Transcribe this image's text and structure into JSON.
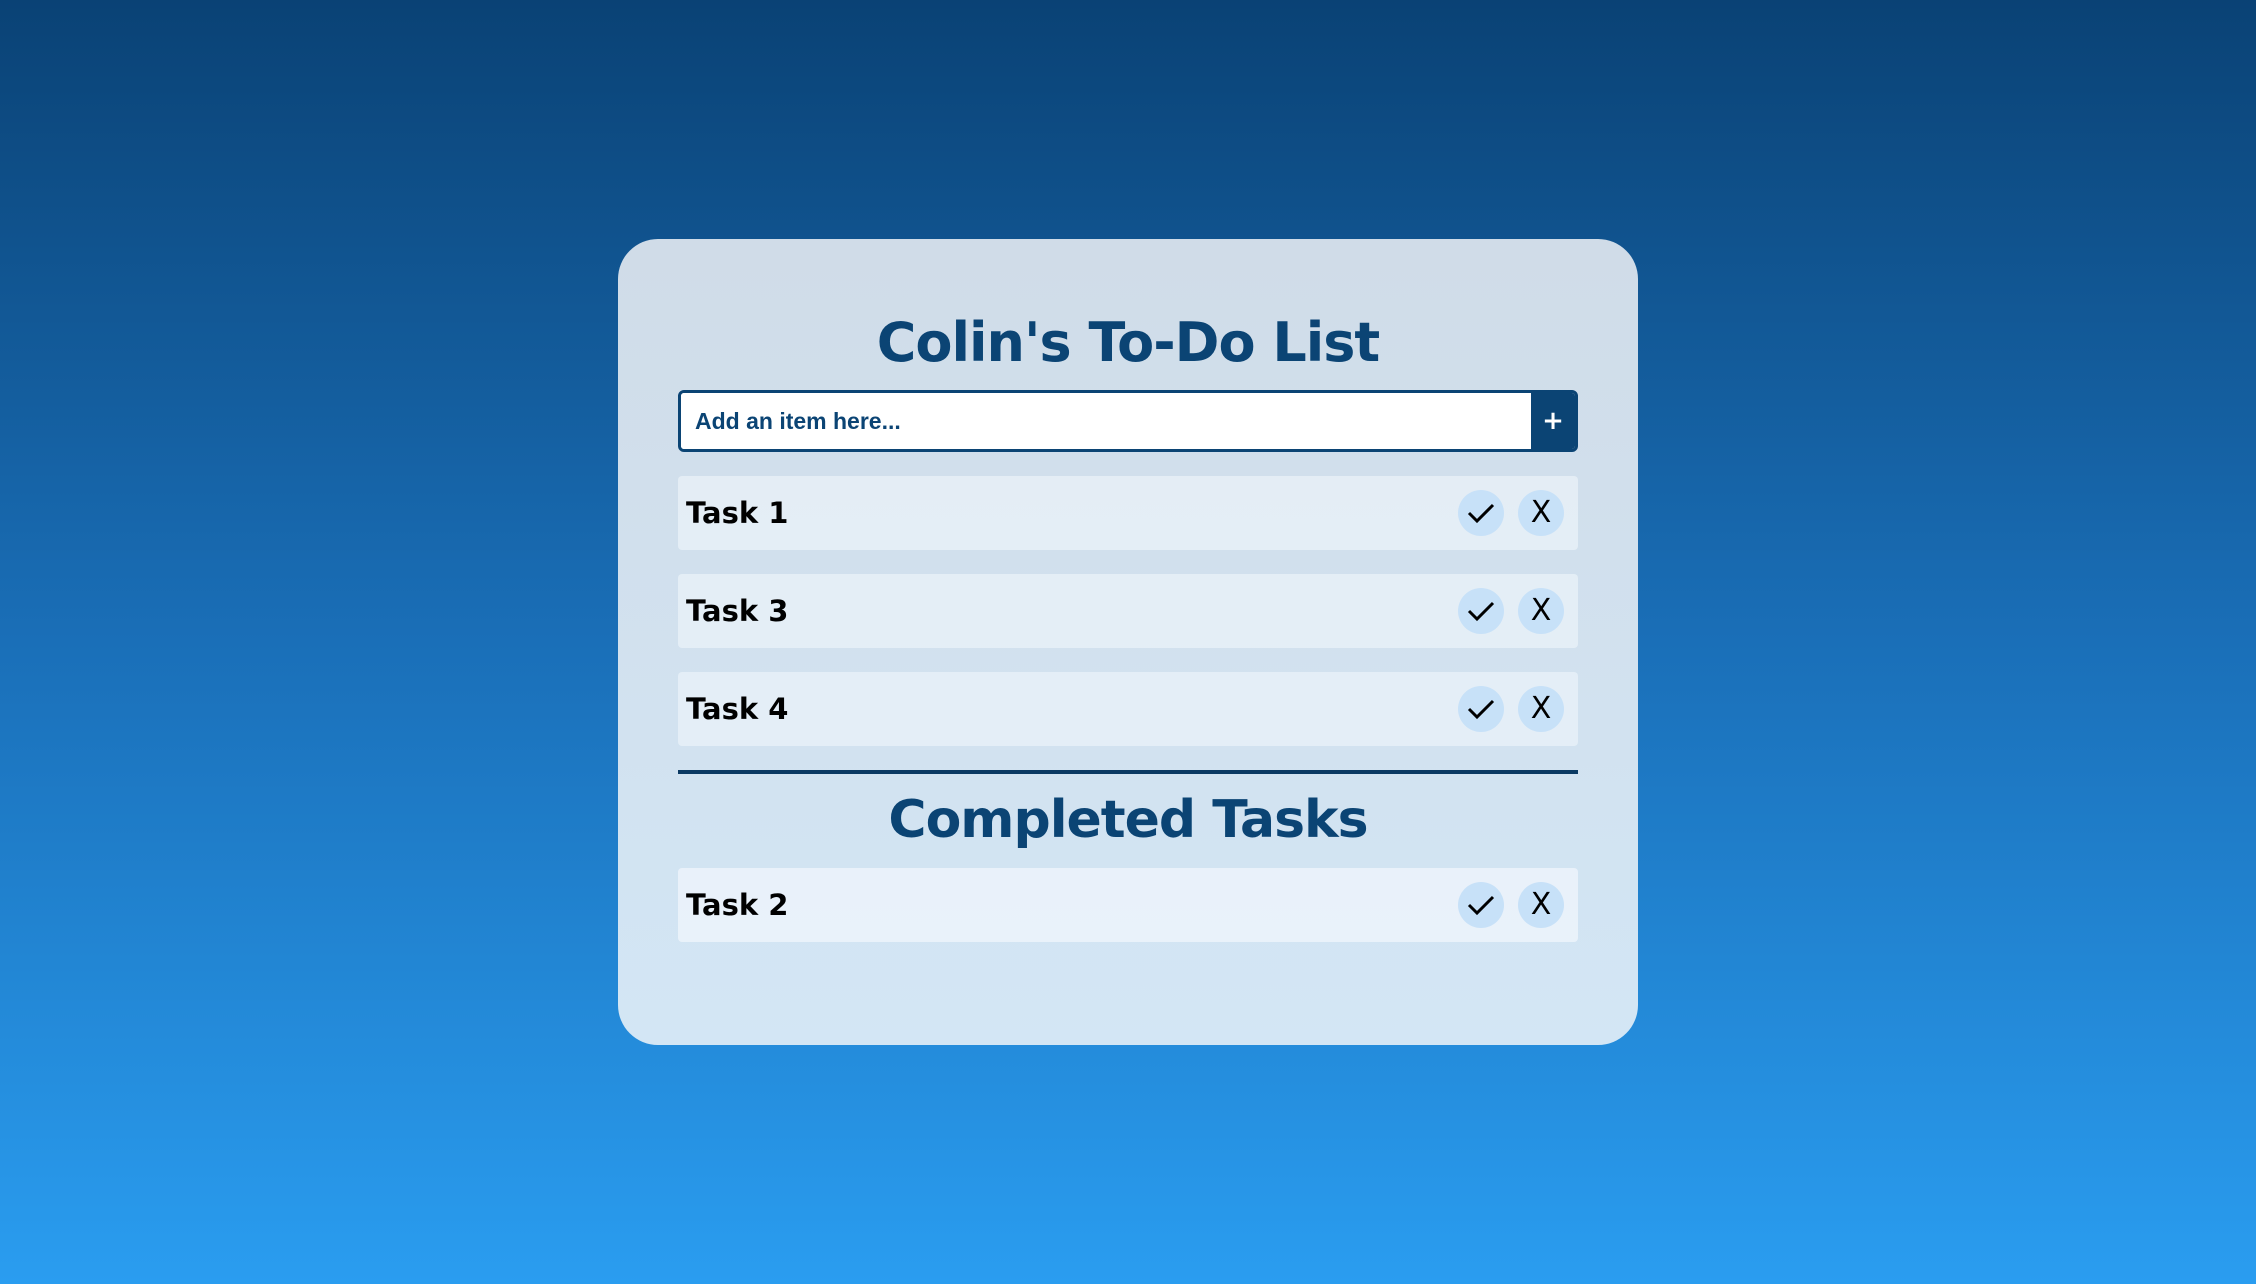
{
  "app": {
    "title": "Colin's To-Do List"
  },
  "add_item": {
    "placeholder": "Add an item here...",
    "button_label": "+"
  },
  "active_tasks": [
    {
      "text": "Task 1",
      "complete_icon": "checkmark-icon",
      "delete_label": "X"
    },
    {
      "text": "Task 3",
      "complete_icon": "checkmark-icon",
      "delete_label": "X"
    },
    {
      "text": "Task 4",
      "complete_icon": "checkmark-icon",
      "delete_label": "X"
    }
  ],
  "completed_section": {
    "title": "Completed Tasks",
    "tasks": [
      {
        "text": "Task 2",
        "complete_icon": "checkmark-icon",
        "delete_label": "X"
      }
    ]
  },
  "colors": {
    "primary": "#0b4474",
    "button_bg": "#c7e1f8",
    "background_top": "#0a4275",
    "background_bottom": "#2a9df0"
  }
}
